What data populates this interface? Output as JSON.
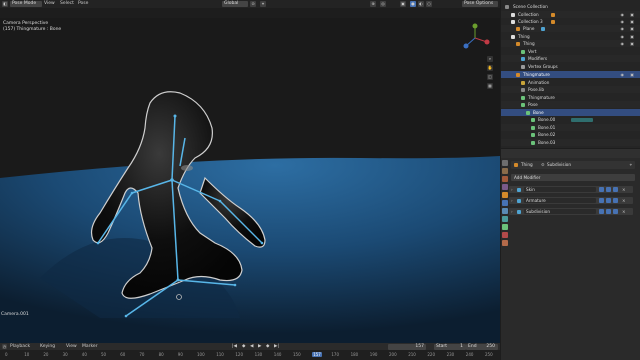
{
  "top_header": {
    "mode": "Pose Mode",
    "menus": [
      "View",
      "Select",
      "Pose"
    ],
    "orientation": "Global",
    "options": "Pose Options"
  },
  "viewport": {
    "camera_label": "Camera Perspective",
    "object_label": "(157) Thingmature : Bone",
    "camera_name": "Camera.001"
  },
  "outliner": {
    "rows": [
      {
        "label": "Scene Collection"
      },
      {
        "label": "Collection"
      },
      {
        "label": "Collection 3"
      },
      {
        "label": "Plane"
      },
      {
        "label": "Thing"
      },
      {
        "label": "Thing"
      },
      {
        "label": "Vert"
      },
      {
        "label": "Modifiers"
      },
      {
        "label": "Vertex Groups"
      },
      {
        "label": "Thingmature"
      },
      {
        "label": "Animation"
      },
      {
        "label": "Pose.lib"
      },
      {
        "label": "Thingmature"
      },
      {
        "label": "Pose"
      },
      {
        "label": "Bone"
      },
      {
        "label": "Bone.00"
      },
      {
        "label": "Bone.01"
      },
      {
        "label": "Bone.02"
      },
      {
        "label": "Bone.03"
      }
    ]
  },
  "properties": {
    "object_name": "Thing",
    "modifier_context": "Subdivision",
    "add_modifier": "Add Modifier",
    "modifiers": [
      "Skin",
      "Armature",
      "Subdivision"
    ]
  },
  "timeline": {
    "menus": [
      "Playback",
      "Keying",
      "View",
      "Marker"
    ],
    "current_frame": "157",
    "start_label": "Start",
    "start": "1",
    "end_label": "End",
    "end": "250",
    "ticks": [
      "0",
      "10",
      "20",
      "30",
      "40",
      "50",
      "60",
      "70",
      "80",
      "90",
      "100",
      "110",
      "120",
      "130",
      "140",
      "150",
      "157",
      "170",
      "180",
      "190",
      "200",
      "210",
      "220",
      "230",
      "240",
      "250"
    ]
  },
  "colors": {
    "accent": "#4772b3",
    "bone": "#58b6e8",
    "floor": "#1e4f7a",
    "selection": "#334d80"
  }
}
